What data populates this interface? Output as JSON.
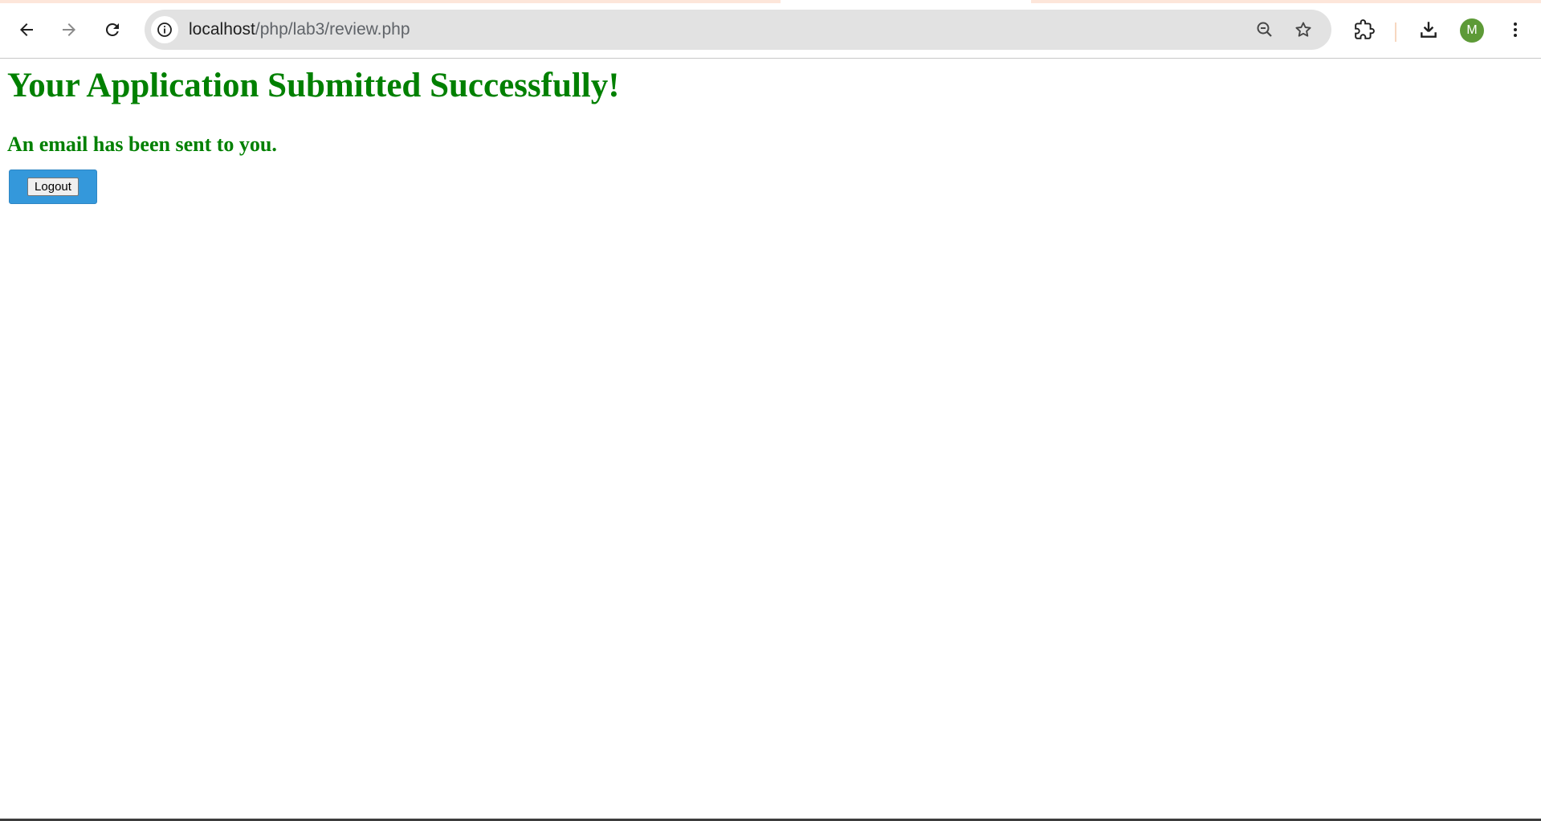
{
  "browser": {
    "url_host": "localhost",
    "url_path": "/php/lab3/review.php",
    "avatar_letter": "M",
    "icons": {
      "back": "arrow-left-icon",
      "forward": "arrow-right-icon",
      "reload": "reload-icon",
      "site_info": "info-icon",
      "zoom": "zoom-out-icon",
      "bookmark": "star-icon",
      "extensions": "puzzle-icon",
      "downloads": "download-icon",
      "menu": "kebab-menu-icon"
    },
    "colors": {
      "tab_accent": "#fde6da",
      "omnibox_bg": "#e2e2e2",
      "avatar_bg": "#5d9a37"
    }
  },
  "page": {
    "heading": "Your Application Submitted Successfully!",
    "subheading": "An email has been sent to you.",
    "logout_label": "Logout",
    "colors": {
      "text": "#008000",
      "button_wrap": "#3498db"
    }
  }
}
